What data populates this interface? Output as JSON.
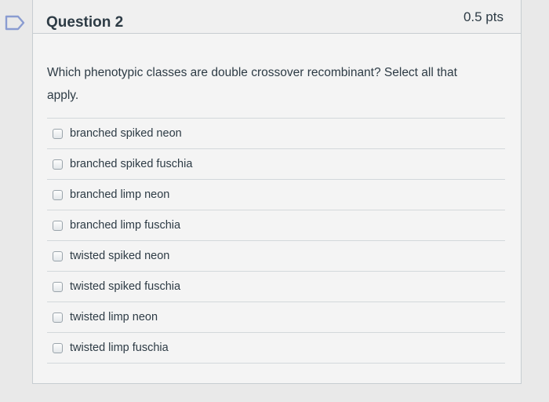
{
  "question": {
    "title": "Question 2",
    "points": "0.5 pts",
    "text": "Which phenotypic classes are double crossover recombinant? Select all that apply."
  },
  "answers": [
    "branched spiked neon",
    "branched spiked fuschia",
    "branched limp neon",
    "branched limp fuschia",
    "twisted spiked neon",
    "twisted spiked fuschia",
    "twisted limp neon",
    "twisted limp fuschia"
  ],
  "icons": {
    "flag": "flag-outline-icon"
  },
  "colors": {
    "text": "#2d3b45",
    "flag": "#8a9cd1",
    "border": "#c7cdd1"
  }
}
